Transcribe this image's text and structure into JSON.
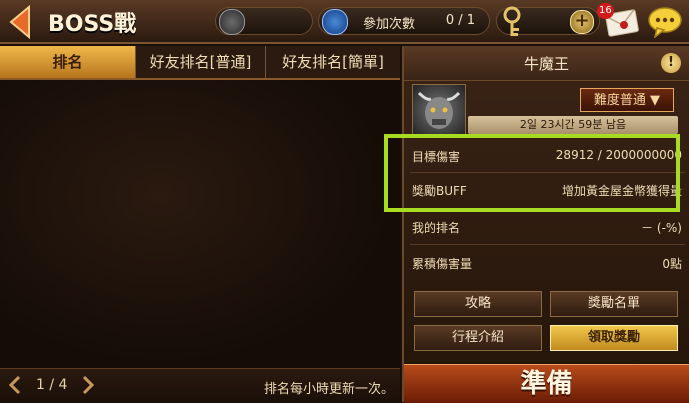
{
  "header": {
    "title": "BOSS戰",
    "participation_label": "參加次數",
    "participation_value": "0 / 1",
    "mail_badge": "16"
  },
  "tabs": [
    "排名",
    "好友排名[普通]",
    "好友排名[簡單]"
  ],
  "list_footer": {
    "page": "1 / 4",
    "note": "排名每小時更新一次。"
  },
  "boss": {
    "name": "牛魔王",
    "difficulty": "難度普通 ▼",
    "timer": "2일 23시간 59분 남음"
  },
  "stats": {
    "target_damage_label": "目標傷害",
    "target_damage_value": "28912 / 2000000000",
    "reward_buff_label": "獎勵BUFF",
    "reward_buff_value": "增加黃金屋金幣獲得量",
    "my_rank_label": "我的排名",
    "my_rank_value": "－   (-%)",
    "cumulative_damage_label": "累積傷害量",
    "cumulative_damage_value": "0點"
  },
  "buttons": {
    "strategy": "攻略",
    "reward_list": "獎勵名單",
    "schedule": "行程介紹",
    "claim_reward": "領取獎勵",
    "ready": "準備"
  }
}
